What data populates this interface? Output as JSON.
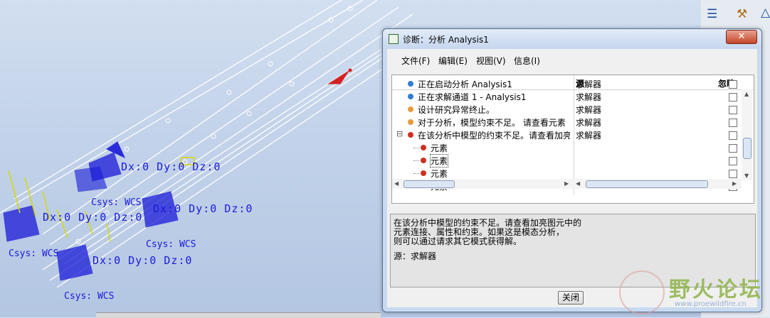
{
  "viewport": {
    "labels": [
      "Dx:0  Dy:0  Dz:0",
      "Dx:0  Dy:0  Dz:0",
      "Dx:0  Dy:0  Dz:0",
      "Dx:0  Dy:0  Dz:0",
      "Csys: WCS",
      "Csys: WCS",
      "Csys: WCS",
      "Csys: WCS"
    ]
  },
  "dialog": {
    "title": "诊断：分析 Analysis1",
    "close_glyph": "✕",
    "menu": [
      "文件(F)",
      "编辑(E)",
      "视图(V)",
      "信息(I)"
    ],
    "columns": {
      "source": "源",
      "ignore": "忽略"
    },
    "rows": [
      {
        "message": "正在启动分析 Analysis1",
        "source": "求解器",
        "level": "info",
        "indent": 1
      },
      {
        "message": "正在求解通道 1 - Analysis1",
        "source": "求解器",
        "level": "info",
        "indent": 1
      },
      {
        "message": "设计研究异常终止。",
        "source": "求解器",
        "level": "warning",
        "indent": 1
      },
      {
        "message": "对于分析，模型约束不足。 请查看元素",
        "source": "求解器",
        "level": "warning",
        "indent": 1
      },
      {
        "message": "在该分析中模型的约束不足。请查看加亮",
        "source": "求解器",
        "level": "error",
        "indent": 1,
        "expand_glyph": "⊟"
      },
      {
        "message": "元素",
        "source": "",
        "level": "error",
        "indent": 2
      },
      {
        "message": "元素",
        "source": "",
        "level": "error",
        "indent": 2,
        "selected": true
      },
      {
        "message": "元素",
        "source": "",
        "level": "error",
        "indent": 2
      },
      {
        "message": "元素",
        "source": "",
        "level": "error",
        "indent": 2
      }
    ],
    "detail": {
      "lines": [
        "在该分析中模型的约束不足。请查看加亮图元中的",
        "元素连接、属性和约束。如果这是模态分析，",
        "则可以通过请求其它模式获得解。"
      ],
      "source_line": "源：求解器"
    },
    "close_button": "关闭"
  },
  "watermark": {
    "text": "野火论坛",
    "url": "www.proewildfire.cn"
  },
  "colors": {
    "cad_blue": "#1a1ad8",
    "info": "#2f7fd0",
    "warning": "#e89a3c",
    "error": "#d0301f"
  }
}
